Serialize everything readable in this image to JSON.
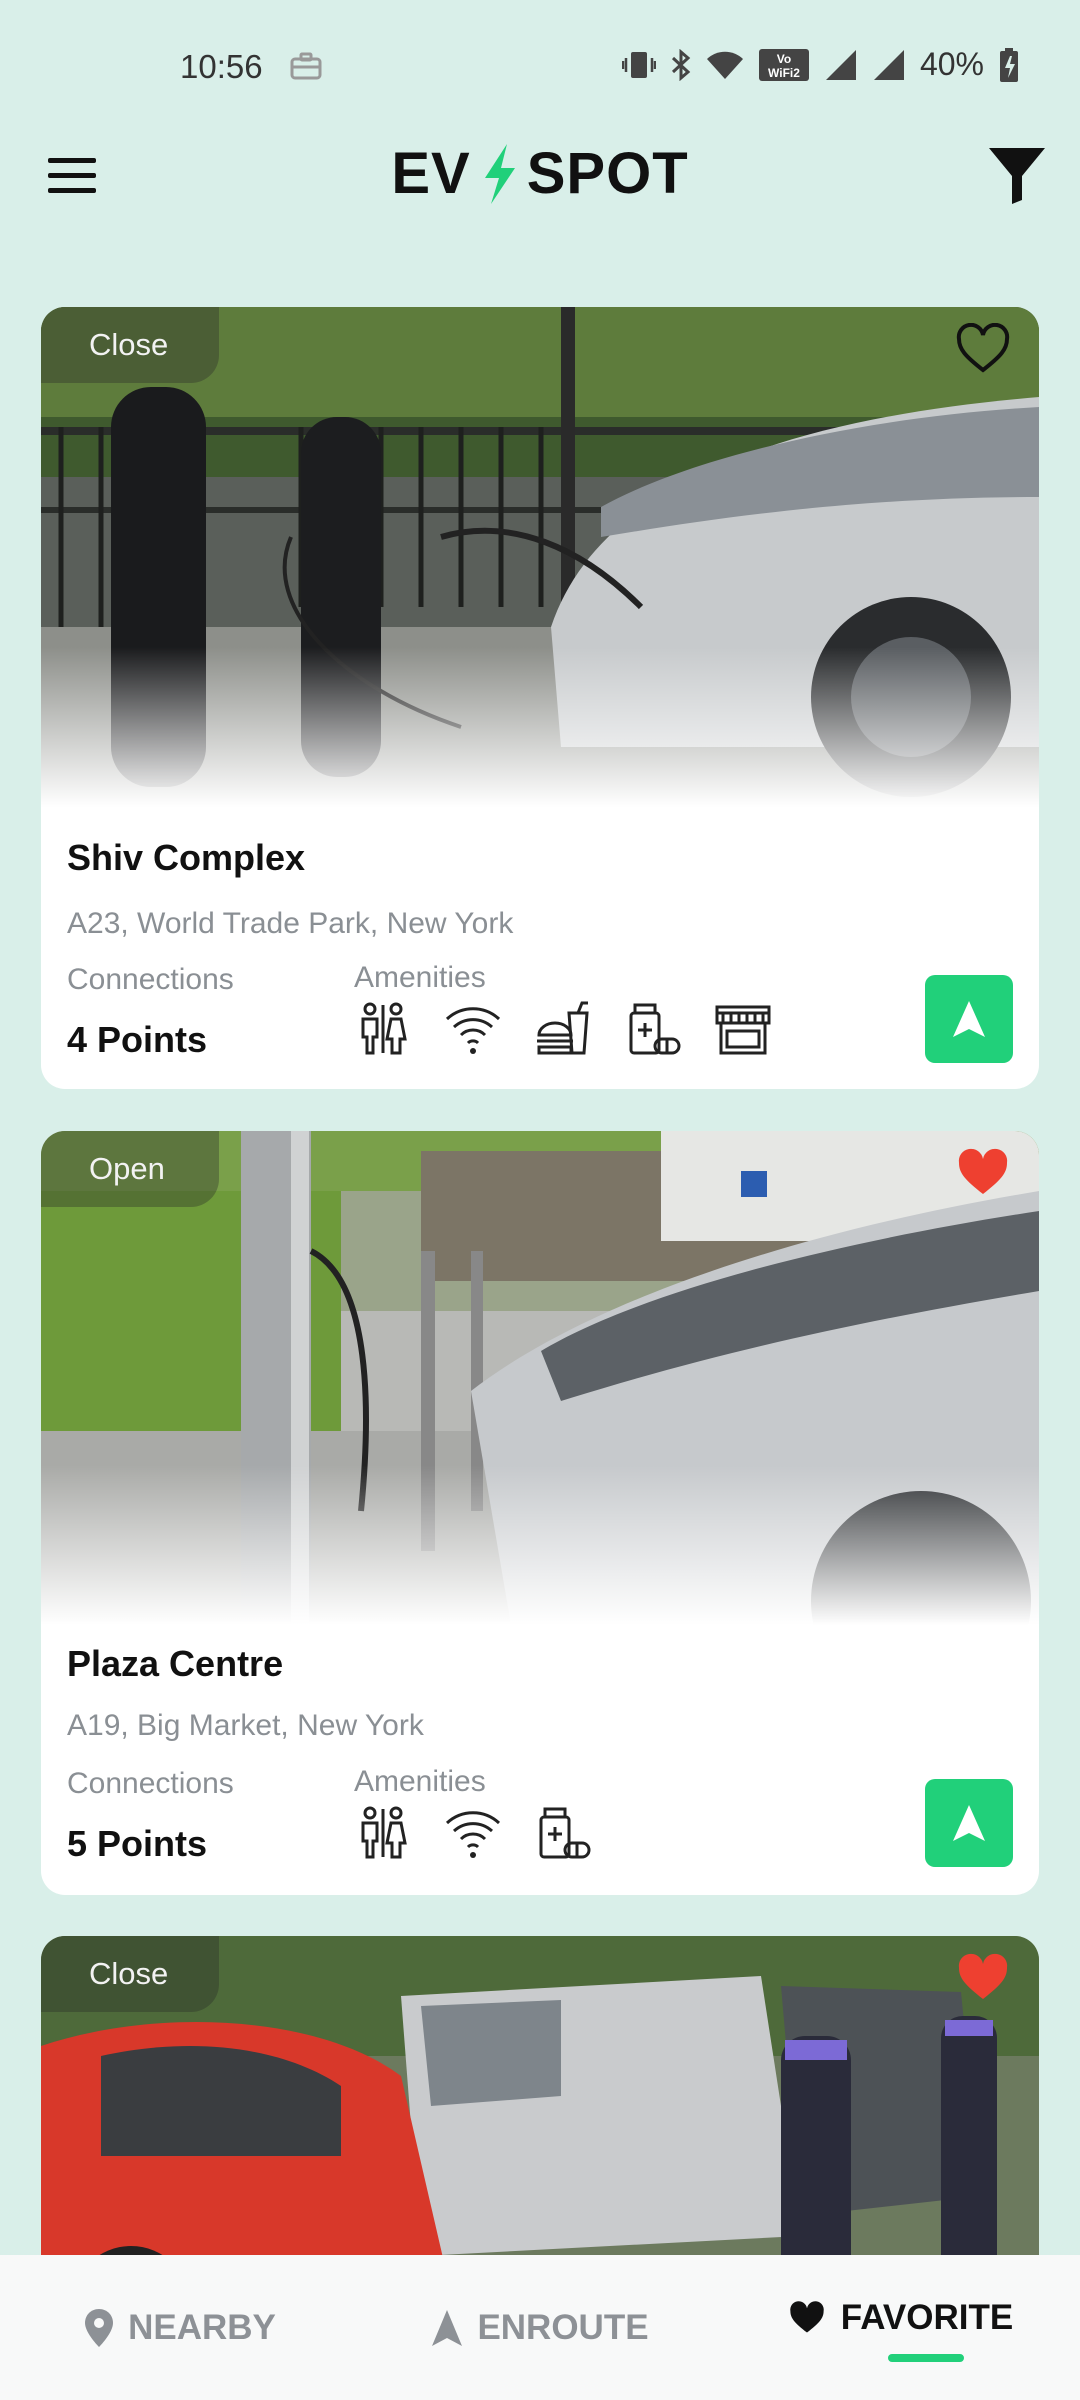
{
  "status_bar": {
    "time": "10:56",
    "battery": "40%",
    "icons": [
      "briefcase-icon",
      "vibrate-icon",
      "bluetooth-icon",
      "wifi-icon",
      "vowifi-icon",
      "signal-icon",
      "signal-icon",
      "battery-icon"
    ]
  },
  "header": {
    "logo_left": "EV",
    "logo_right": "SPOT",
    "accent": "#21d07a"
  },
  "cards": [
    {
      "status": "Close",
      "favorite": false,
      "name": "Shiv Complex",
      "address": "A23, World Trade Park, New York",
      "connections_label": "Connections",
      "connections_value": "4 Points",
      "amenities_label": "Amenities",
      "amenities": [
        "restroom-icon",
        "wifi-icon",
        "food-icon",
        "pharmacy-icon",
        "store-icon"
      ]
    },
    {
      "status": "Open",
      "favorite": true,
      "name": "Plaza Centre",
      "address": "A19, Big Market, New York",
      "connections_label": "Connections",
      "connections_value": "5 Points",
      "amenities_label": "Amenities",
      "amenities": [
        "restroom-icon",
        "wifi-icon",
        "pharmacy-icon"
      ]
    },
    {
      "status": "Close",
      "favorite": true
    }
  ],
  "bottom_nav": {
    "items": [
      {
        "label": "NEARBY",
        "icon": "location-pin-icon",
        "active": false
      },
      {
        "label": "ENROUTE",
        "icon": "navigation-arrow-icon",
        "active": false
      },
      {
        "label": "FAVORITE",
        "icon": "heart-icon",
        "active": true
      }
    ]
  },
  "colors": {
    "background": "#d9efe9",
    "accent": "#21d07a",
    "favorite": "#ee4030"
  }
}
